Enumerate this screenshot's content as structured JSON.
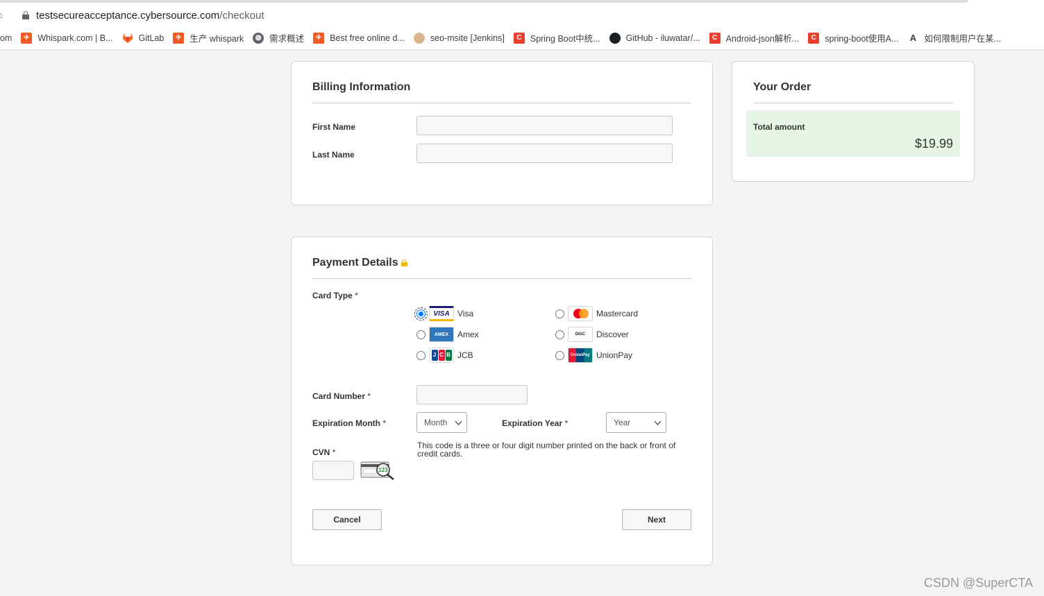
{
  "browser": {
    "url_host": "testsecureacceptance.cybersource.com",
    "url_path": "/checkout",
    "bookmarks": [
      {
        "label": "om",
        "icon": "none"
      },
      {
        "label": "Whispark.com | B...",
        "icon": "whispark-icon"
      },
      {
        "label": "GitLab",
        "icon": "gitlab-icon"
      },
      {
        "label": "生产 whispark",
        "icon": "whispark-icon"
      },
      {
        "label": "需求概述",
        "icon": "globe-icon"
      },
      {
        "label": "Best free online d...",
        "icon": "whispark-icon"
      },
      {
        "label": "seo-msite [Jenkins]",
        "icon": "jenkins-icon"
      },
      {
        "label": "Spring Boot中统...",
        "icon": "csdn-icon"
      },
      {
        "label": "GitHub - iluwatar/...",
        "icon": "github-icon"
      },
      {
        "label": "Android-json解析...",
        "icon": "csdn-icon"
      },
      {
        "label": "spring-boot使用A...",
        "icon": "csdn-icon"
      },
      {
        "label": "如何限制用户在某...",
        "icon": "a-icon"
      }
    ]
  },
  "billing": {
    "title": "Billing Information",
    "first_name_label": "First Name",
    "first_name_value": "",
    "last_name_label": "Last Name",
    "last_name_value": ""
  },
  "order": {
    "title": "Your Order",
    "total_label": "Total amount",
    "total_amount": "$19.99"
  },
  "payment": {
    "title": "Payment Details",
    "card_type_label": "Card Type",
    "required_mark": "*",
    "card_types": [
      {
        "label": "Visa",
        "logo_text": "VISA",
        "checked": true
      },
      {
        "label": "Mastercard",
        "logo_text": "",
        "checked": false
      },
      {
        "label": "Amex",
        "logo_text": "AMEX",
        "checked": false
      },
      {
        "label": "Discover",
        "logo_text": "DISC",
        "checked": false
      },
      {
        "label": "JCB",
        "logo_text": "JCB",
        "checked": false
      },
      {
        "label": "UnionPay",
        "logo_text": "UnionPay",
        "checked": false
      }
    ],
    "card_number_label": "Card Number",
    "card_number_value": "",
    "exp_month_label": "Expiration Month",
    "exp_month_selected": "Month",
    "exp_year_label": "Expiration Year",
    "exp_year_selected": "Year",
    "cvn_label": "CVN",
    "cvn_value": "",
    "cvn_note": "This code is a three or four digit number printed on the back or front of credit cards.",
    "cvn_card_digits": "123",
    "cancel_label": "Cancel",
    "next_label": "Next"
  },
  "watermark": "CSDN @SuperCTA",
  "colors": {
    "radio_checked": "#0075ff",
    "total_bg": "#e7f5e7",
    "lock": "#f2b600"
  }
}
